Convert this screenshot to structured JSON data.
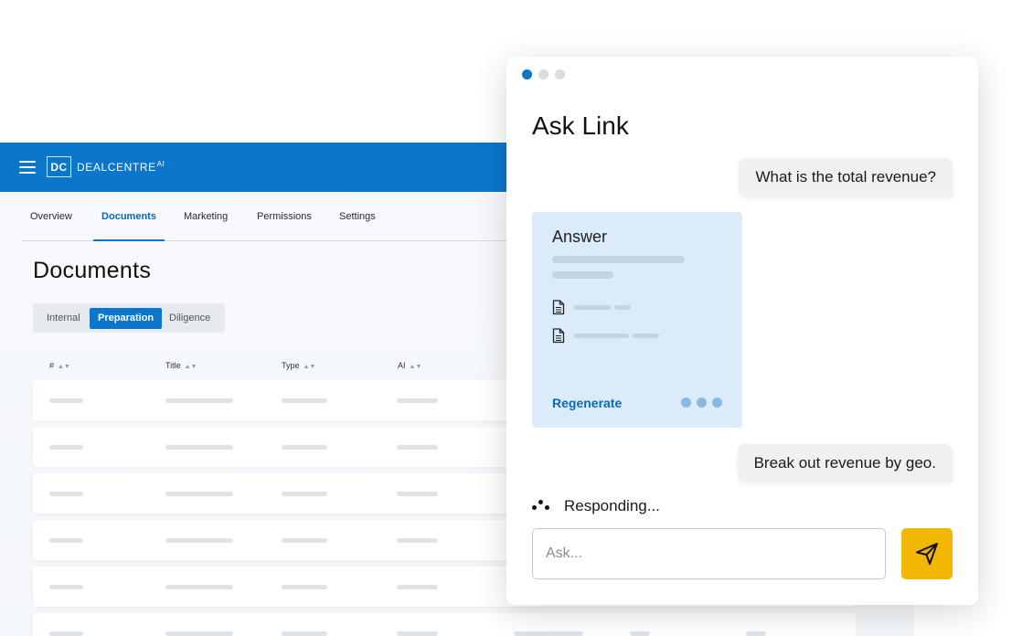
{
  "app": {
    "brand": {
      "abbr": "DC",
      "name": "DEALCENTRE",
      "suffix": "AI"
    },
    "nav_tabs": [
      {
        "label": "Overview",
        "active": false
      },
      {
        "label": "Documents",
        "active": true
      },
      {
        "label": "Marketing",
        "active": false
      },
      {
        "label": "Permissions",
        "active": false
      },
      {
        "label": "Settings",
        "active": false
      }
    ],
    "page_title": "Documents",
    "segments": [
      {
        "label": "Internal",
        "active": false
      },
      {
        "label": "Preparation",
        "active": true
      },
      {
        "label": "Diligence",
        "active": false
      }
    ],
    "table_headers": [
      "#",
      "Title",
      "Type",
      "AI"
    ],
    "accent_color": "#0a77cc"
  },
  "chat": {
    "title": "Ask Link",
    "messages": [
      {
        "role": "user",
        "text": "What is the total revenue?"
      },
      {
        "role": "user",
        "text": "Break out revenue by geo."
      }
    ],
    "answer_card": {
      "title": "Answer",
      "action_label": "Regenerate"
    },
    "status_text": "Responding...",
    "input": {
      "placeholder": "Ask...",
      "value": ""
    },
    "send_icon": "paper-plane-icon",
    "send_color": "#f2b705"
  }
}
